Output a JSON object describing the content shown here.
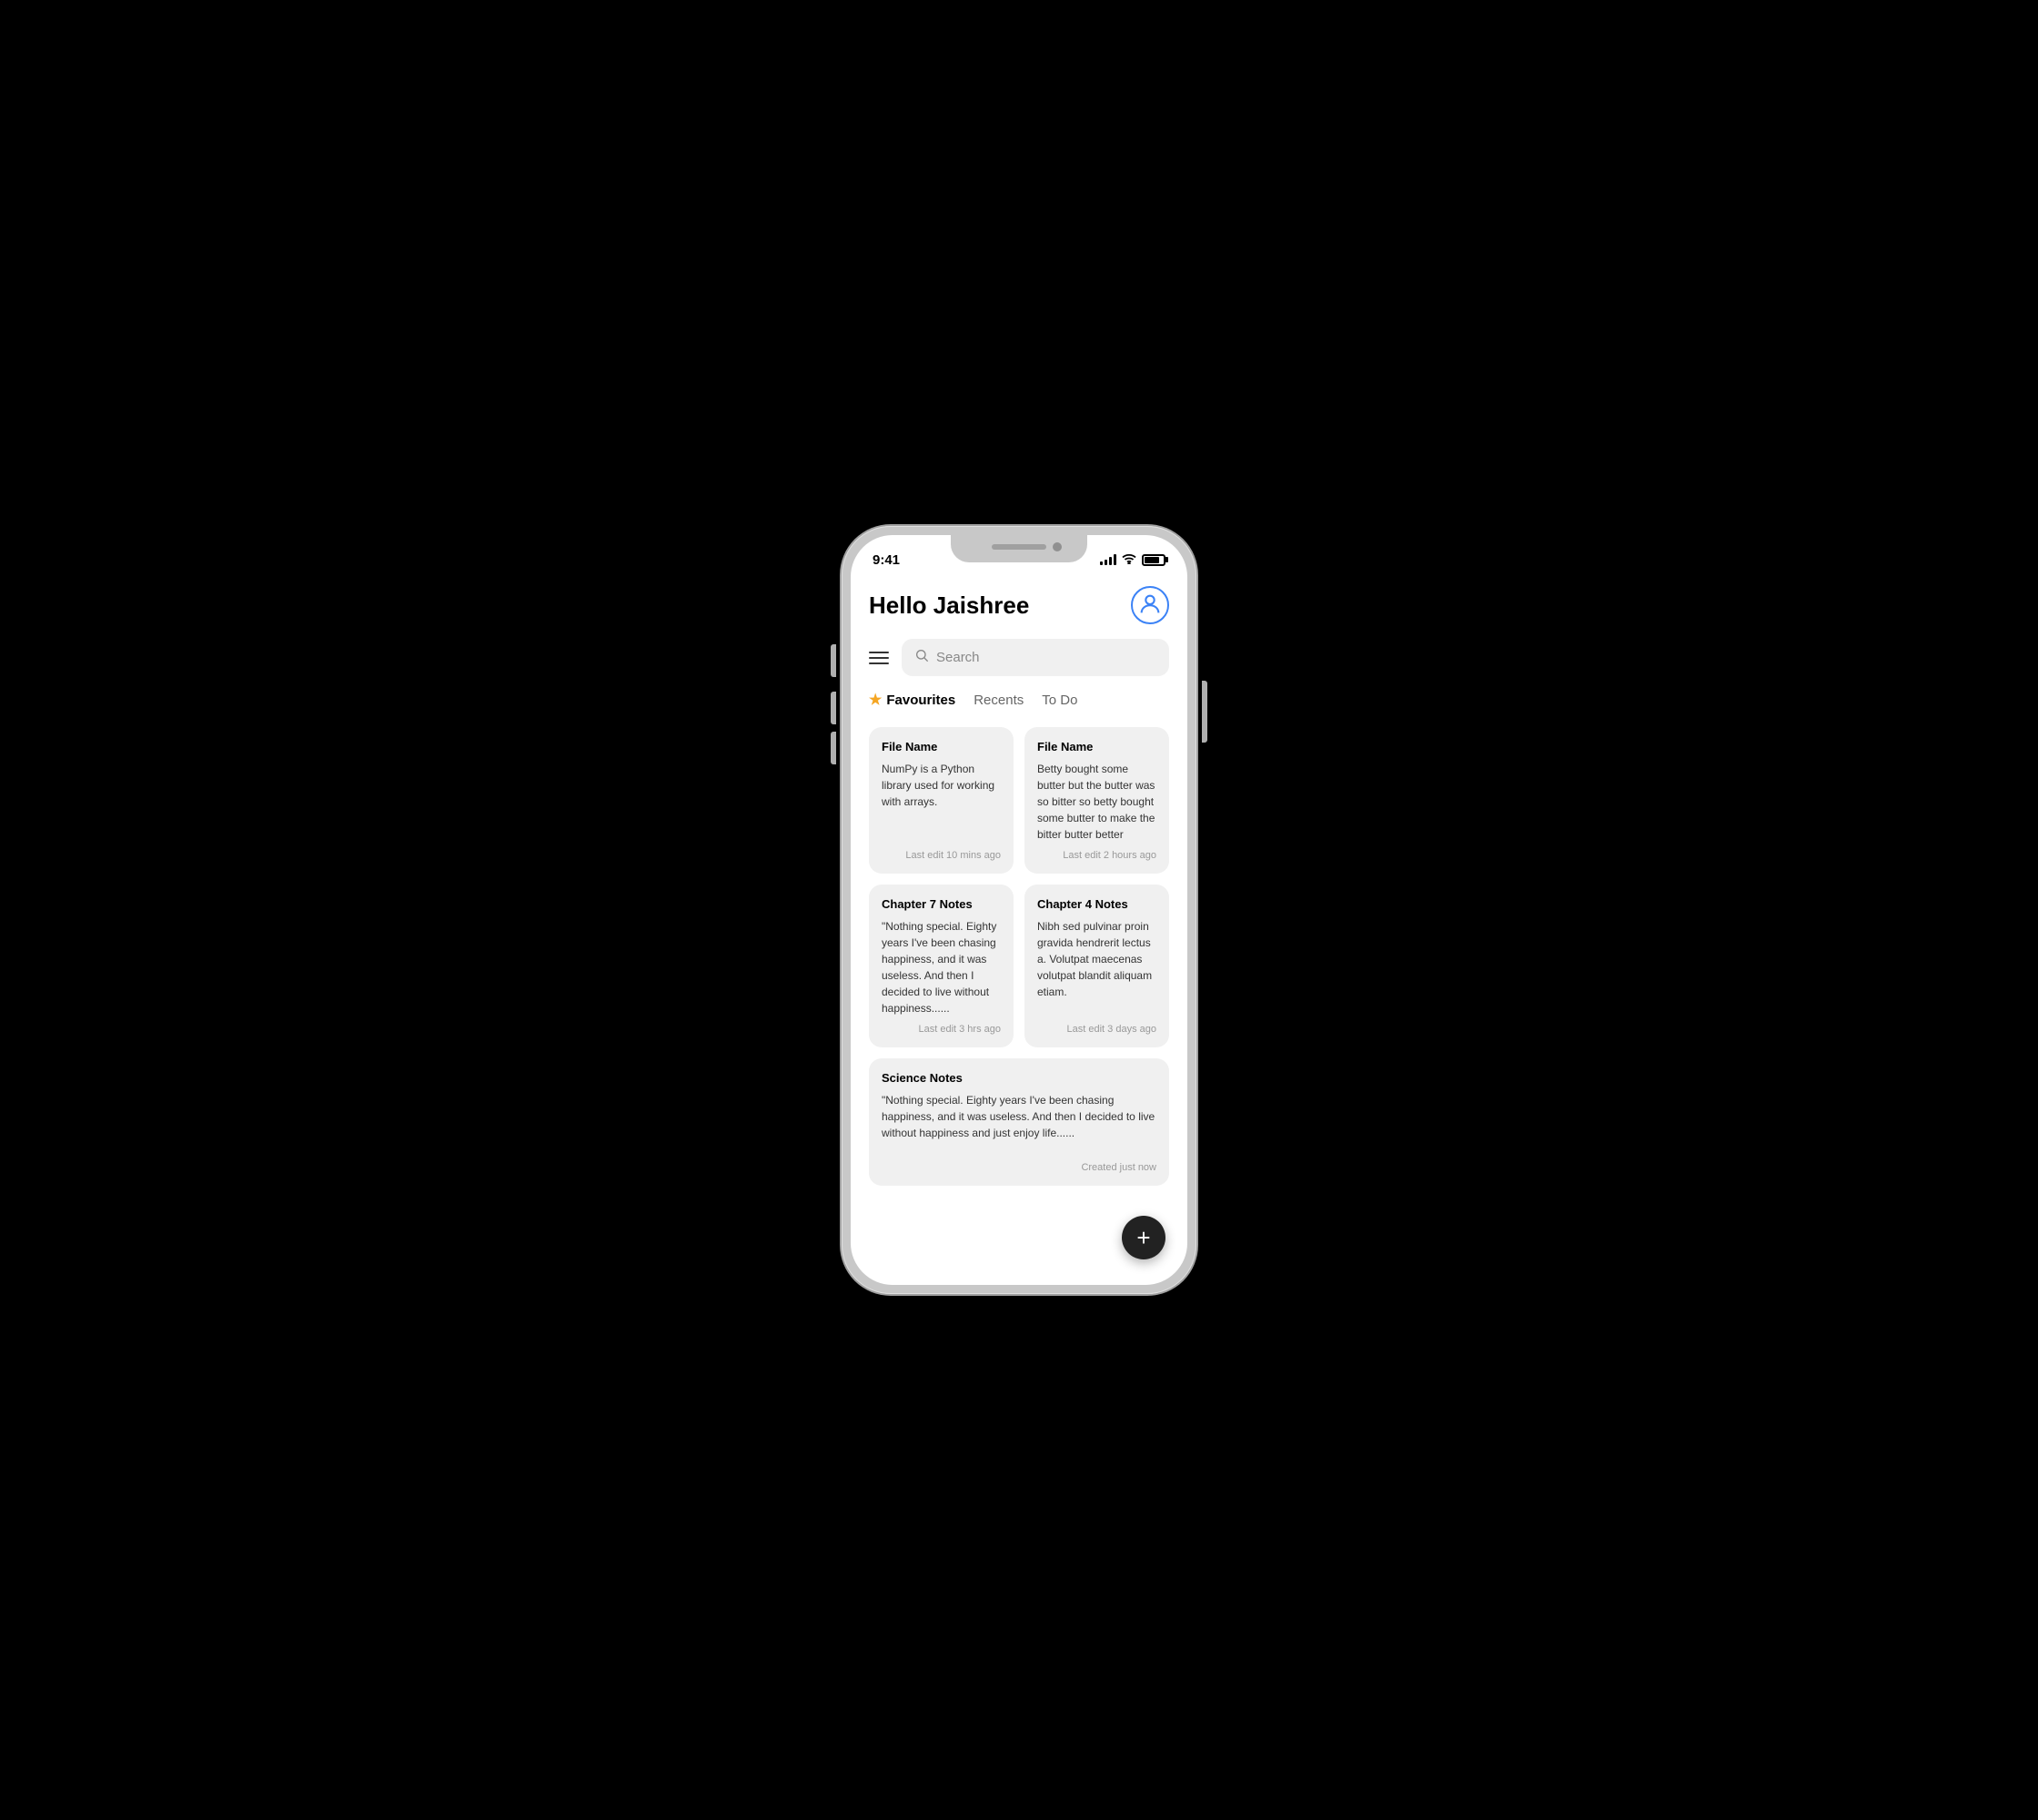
{
  "status_bar": {
    "time": "9:41"
  },
  "header": {
    "title": "Hello Jaishree"
  },
  "search": {
    "placeholder": "Search"
  },
  "tabs": [
    {
      "id": "favourites",
      "label": "Favourites",
      "active": true
    },
    {
      "id": "recents",
      "label": "Recents",
      "active": false
    },
    {
      "id": "todo",
      "label": "To Do",
      "active": false
    }
  ],
  "notes": [
    {
      "id": "note1",
      "title": "File Name",
      "body": "NumPy is a Python library used for working with arrays.",
      "footer": "Last edit 10 mins ago",
      "full_width": false
    },
    {
      "id": "note2",
      "title": "File Name",
      "body": "Betty bought some butter but the butter was so bitter so betty bought some butter to make the bitter butter better",
      "footer": "Last edit 2 hours ago",
      "full_width": false
    },
    {
      "id": "note3",
      "title": "Chapter 7 Notes",
      "body": "\"Nothing special. Eighty years I've been chasing happiness, and it was useless. And then I decided to live without happiness......",
      "footer": "Last edit 3 hrs ago",
      "full_width": false
    },
    {
      "id": "note4",
      "title": "Chapter 4 Notes",
      "body": "Nibh sed pulvinar proin gravida hendrerit lectus a. Volutpat maecenas volutpat blandit aliquam etiam.",
      "footer": "Last edit 3 days ago",
      "full_width": false
    },
    {
      "id": "note5",
      "title": "Science Notes",
      "body": "\"Nothing special. Eighty years I've been chasing happiness, and it was useless. And then I decided to live without happiness and just enjoy life......",
      "footer": "Created just now",
      "full_width": true
    }
  ],
  "fab": {
    "label": "+"
  }
}
